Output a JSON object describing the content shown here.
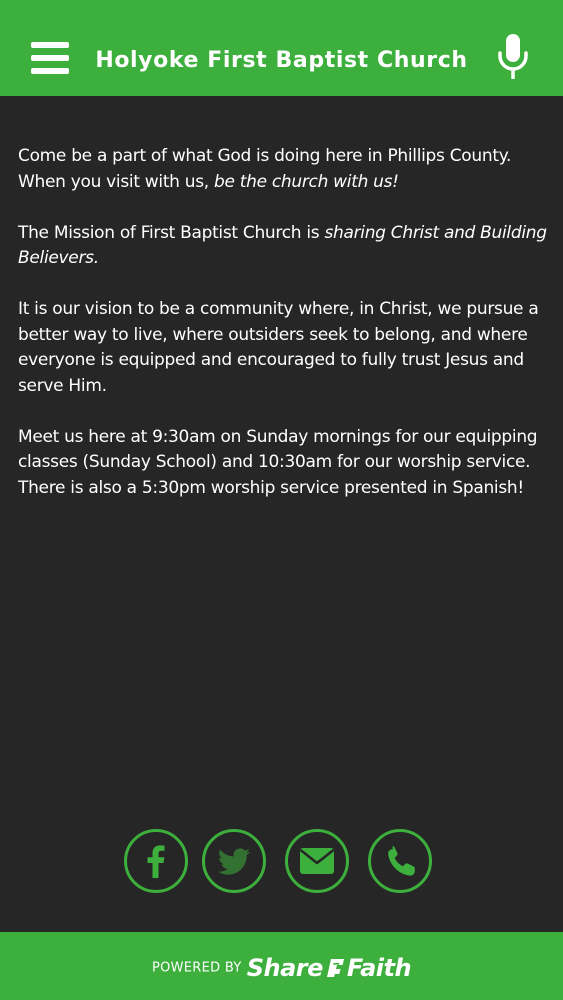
{
  "header": {
    "title": "Holyoke First Baptist Church",
    "menu_icon": "hamburger-menu-icon",
    "mic_icon": "microphone-icon",
    "background_color": "#3daf3d"
  },
  "content": {
    "paragraphs": [
      {
        "text": "Come be a part of what God is doing here in Phillips County. When you visit with us, ",
        "italic": "be the church with us!"
      },
      {
        "text": "The Mission of First Baptist Church is ",
        "italic": "sharing Christ and Building Believers."
      },
      {
        "text": "It is our vision to be a community where, in Christ, we pursue a better way to live, where outsiders seek to belong, and where everyone is equipped and encouraged to fully trust Jesus and serve Him."
      },
      {
        "text": "Meet us here at 9:30am on Sunday mornings for our equipping classes (Sunday School) and 10:30am for our worship service. There is also a 5:30pm worship service presented in Spanish!"
      }
    ]
  },
  "social": [
    {
      "icon": "facebook-icon"
    },
    {
      "icon": "twitter-icon"
    },
    {
      "icon": "email-icon"
    },
    {
      "icon": "phone-icon"
    }
  ],
  "footer": {
    "powered_by": "POWERED BY",
    "brand_part1": "Share",
    "brand_part2": "Faith",
    "brand_icon": "sharefaith-logo-icon",
    "background_color": "#3daf3d"
  },
  "colors": {
    "accent": "#3daf3d",
    "background": "#262626",
    "text": "#ffffff"
  }
}
